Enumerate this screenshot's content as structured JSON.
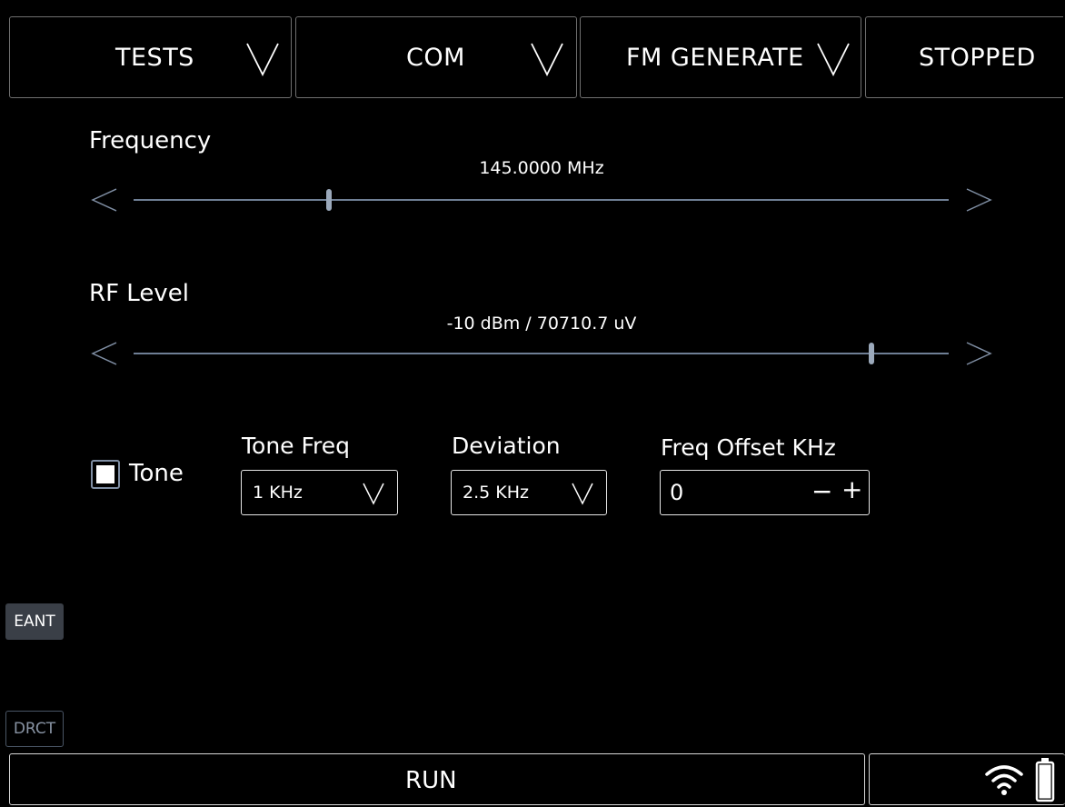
{
  "top_bar": {
    "tests_label": "TESTS",
    "com_label": "COM",
    "mode_label": "FM GENERATE",
    "status_label": "STOPPED"
  },
  "frequency": {
    "label": "Frequency",
    "value": "145.0000 MHz",
    "slider_fraction": 0.24
  },
  "rf_level": {
    "label": "RF Level",
    "value": "-10 dBm / 70710.7 uV",
    "slider_fraction": 0.905
  },
  "tone": {
    "checkbox_label": "Tone",
    "checked": false
  },
  "tone_freq": {
    "label": "Tone Freq",
    "value": "1 KHz"
  },
  "deviation": {
    "label": "Deviation",
    "value": "2.5 KHz"
  },
  "freq_offset": {
    "label": "Freq Offset KHz",
    "value": "0",
    "minus": "−",
    "plus": "+"
  },
  "side_buttons": {
    "eant": "EANT",
    "drct": "DRCT"
  },
  "bottom_bar": {
    "run_label": "RUN"
  },
  "icons": [
    "chevron-down-icon",
    "chevron-left-icon",
    "chevron-right-icon",
    "wifi-icon",
    "battery-icon"
  ]
}
